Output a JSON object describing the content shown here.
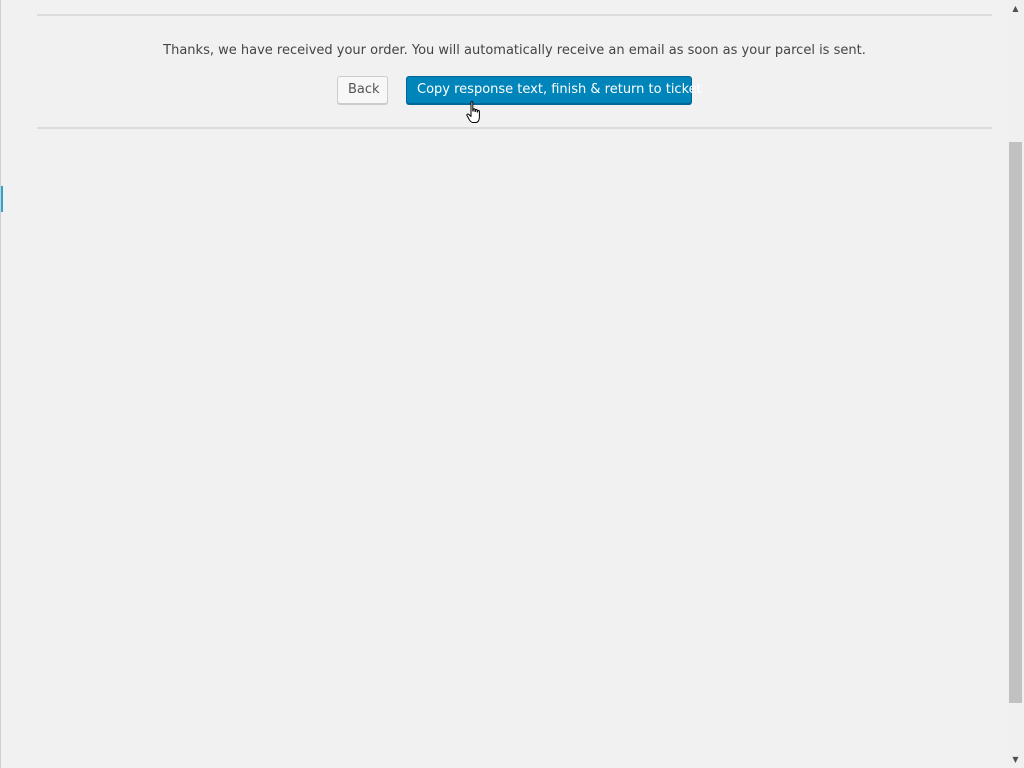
{
  "message": {
    "text": "Thanks, we have received your order. You will automatically receive an email as soon as your parcel is sent."
  },
  "actions": {
    "back_label": "Back",
    "finish_label": "Copy response text, finish & return to ticket"
  },
  "scrollbar": {
    "up_arrow": "▲",
    "down_arrow": "▼"
  },
  "colors": {
    "background": "#f1f1f1",
    "primary_button": "#0085ba",
    "divider": "#dcdcdc"
  },
  "icons": {
    "cursor": "hand-pointer-icon"
  }
}
